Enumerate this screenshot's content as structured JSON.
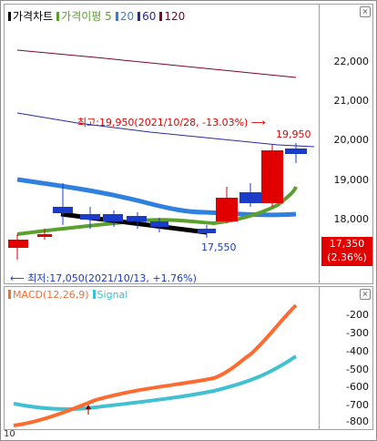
{
  "legend": {
    "price": "가격차트",
    "ma_label": "가격이평",
    "ma_periods": [
      "5",
      "20",
      "60",
      "120"
    ]
  },
  "macd_legend": {
    "macd": "MACD(12,26,9)",
    "signal": "Signal"
  },
  "price_axis": [
    "22,000",
    "21,000",
    "20,000",
    "19,000",
    "18,000"
  ],
  "current_price": "17,350",
  "current_change": "(2.36%)",
  "high_annotation": "최고:19,950(2021/10/28, -13.03%)",
  "high_arrow": "⟶",
  "low_annotation": "최저:17,050(2021/10/13, +1.76%)",
  "low_arrow": "⟵",
  "high_label": "19,950",
  "low_label": "17,550",
  "macd_axis": [
    "-200",
    "-300",
    "-400",
    "-500",
    "-600",
    "-700",
    "-800"
  ],
  "x_label": "10",
  "colors": {
    "ma5": "#5aa02c",
    "ma20": "#3080e0",
    "ma60": "#2a2aa0",
    "ma120": "#800030",
    "up": "#e00000",
    "down": "#1a3cc8",
    "macd": "#ff6a30",
    "signal": "#40c0d0"
  }
}
